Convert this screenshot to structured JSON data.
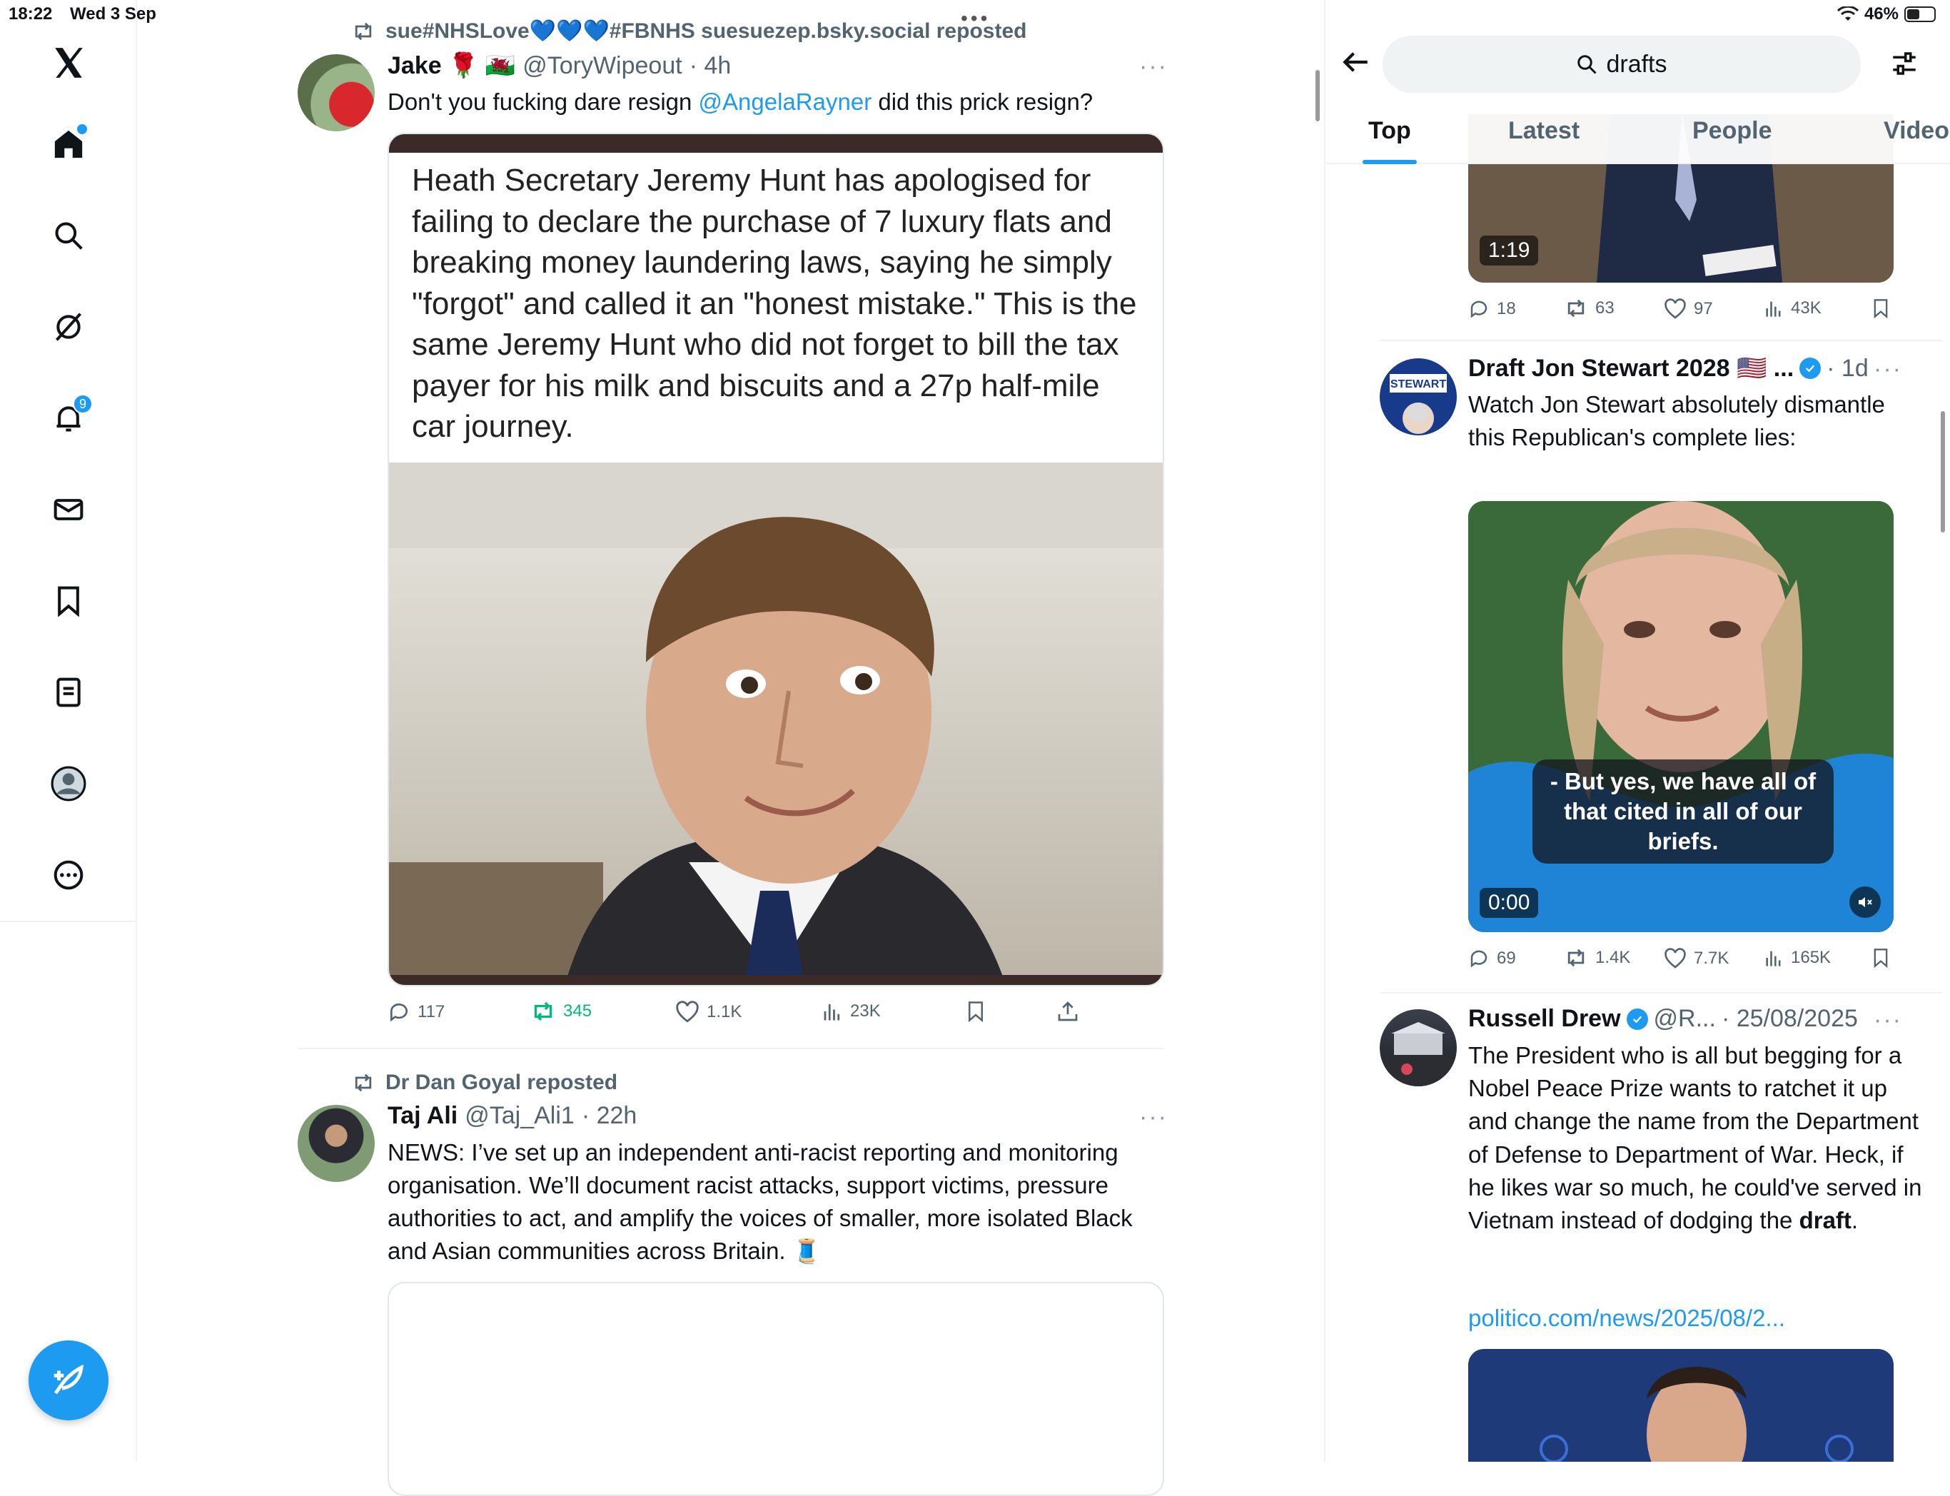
{
  "status": {
    "time": "18:22",
    "date": "Wed 3 Sep",
    "battery": "46%",
    "battery_level": 0.46
  },
  "nav": {
    "notification_count": "9"
  },
  "feed": {
    "tweet1": {
      "repost_label": "sue#NHSLove💙💙💙#FBNHS suesuezep.bsky.social reposted",
      "name": "Jake 🌹 🏴󠁧󠁢󠁷󠁬󠁳󠁿",
      "handle": "@ToryWipeout",
      "time": "· 4h",
      "text_before": "Don't you fucking dare resign ",
      "mention": "@AngelaRayner",
      "text_after": " did this prick resign?",
      "image_caption": "Heath Secretary Jeremy Hunt has apologised for failing to declare the purchase of 7 luxury flats and breaking money laundering laws, saying he simply \"forgot\" and called it an \"honest mistake.\" This is the same Jeremy Hunt who did not forget  to bill the tax payer for his milk and biscuits and  a 27p half-mile car journey.",
      "replies": "117",
      "reposts": "345",
      "likes": "1.1K",
      "views": "23K"
    },
    "tweet2": {
      "repost_label": "Dr Dan Goyal reposted",
      "name": "Taj Ali",
      "handle": "@Taj_Ali1",
      "time": "· 22h",
      "text": "NEWS: I’ve set up an independent anti-racist reporting and monitoring organisation. We’ll document racist attacks, support victims, pressure authorities to act, and amplify the voices of smaller, more isolated Black and Asian communities across Britain. 🧵"
    }
  },
  "search": {
    "query": "drafts",
    "tabs": [
      "Top",
      "Latest",
      "People",
      "Video"
    ],
    "result0": {
      "video_time": "1:19",
      "replies": "18",
      "reposts": "63",
      "likes": "97",
      "views": "43K"
    },
    "result1": {
      "name": "Draft Jon Stewart 2028 🇺🇸 ...",
      "time": "· 1d",
      "text": "Watch Jon Stewart absolutely dismantle this Republican's complete lies:",
      "subtitle": "- But yes, we have all of that cited in all of our briefs.",
      "video_time": "0:00",
      "replies": "69",
      "reposts": "1.4K",
      "likes": "7.7K",
      "views": "165K"
    },
    "result2": {
      "name": "Russell Drew",
      "handle": "@R...",
      "time": "· 25/08/2025",
      "text_before": "The President who is all but begging for a Nobel Peace Prize wants to ratchet it up and change the name from the Department of Defense to Department of War. Heck, if he likes war so much, he could've served in Vietnam instead of dodging the ",
      "text_bold": "draft",
      "text_after": ".",
      "link": "politico.com/news/2025/08/2..."
    }
  },
  "colors": {
    "accent": "#1d9bf0",
    "repost_green": "#00ba7c",
    "muted": "#536471"
  }
}
